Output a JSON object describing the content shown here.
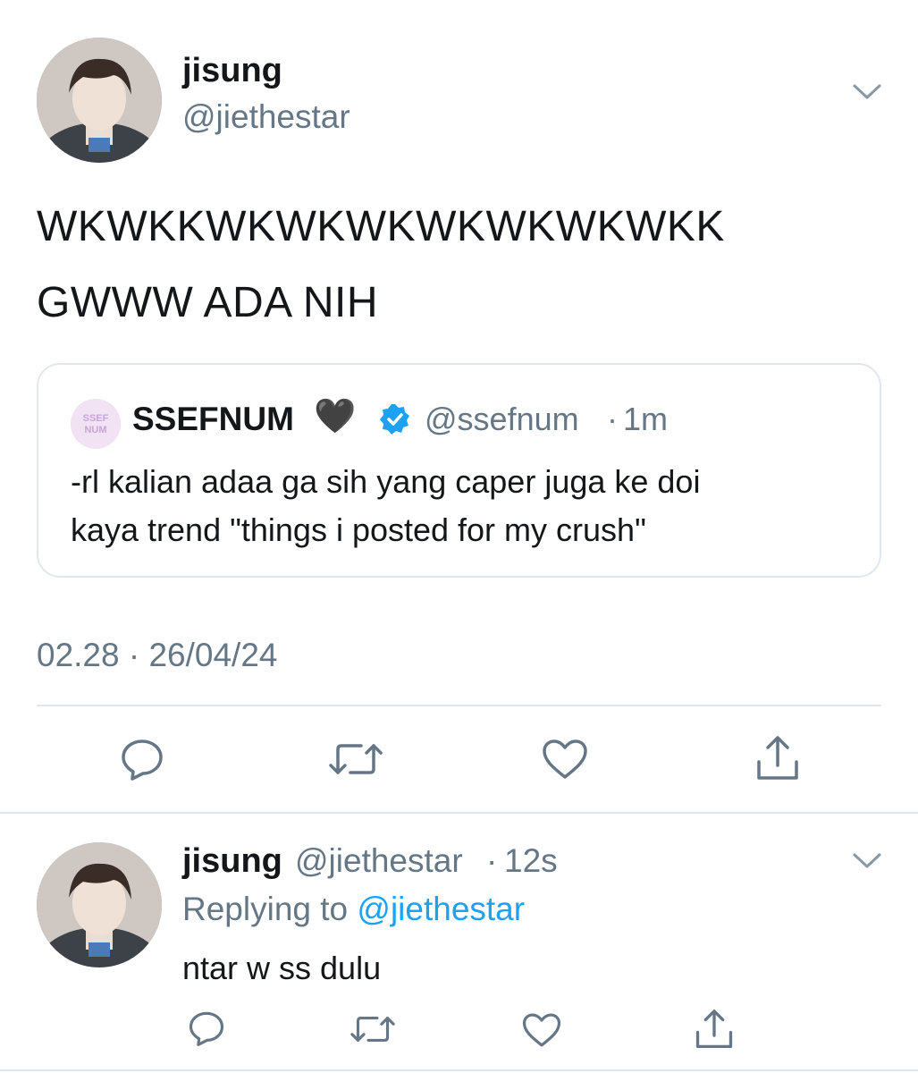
{
  "main_tweet": {
    "author_name": "jisung",
    "author_handle": "@jiethestar",
    "text_line1": "WKWKKWKWKWKWKWKWKWKK",
    "text_line2": "GWWW ADA NIH",
    "timestamp": "02.28 · 26/04/24"
  },
  "quoted_tweet": {
    "avatar_text": "SSEF NUM",
    "author_name": "SSEFNUM",
    "emoji": "🖤",
    "author_handle": "@ssefnum",
    "separator": "·",
    "time": "1m",
    "text_line1": "-rl kalian adaa ga sih yang caper juga ke doi",
    "text_line2": "kaya trend \"things i posted for my crush\""
  },
  "reply_tweet": {
    "author_name": "jisung",
    "author_handle": "@jiethestar",
    "separator": "·",
    "time": "12s",
    "replying_prefix": "Replying to",
    "replying_handle": "@jiethestar",
    "text": "ntar w ss dulu"
  },
  "colors": {
    "text": "#14171a",
    "secondary": "#657786",
    "accent": "#1da1f2",
    "border": "#e1e8ed"
  },
  "icons": [
    "chevron-down-icon",
    "reply-icon",
    "retweet-icon",
    "like-icon",
    "share-icon",
    "verified-badge-icon"
  ]
}
